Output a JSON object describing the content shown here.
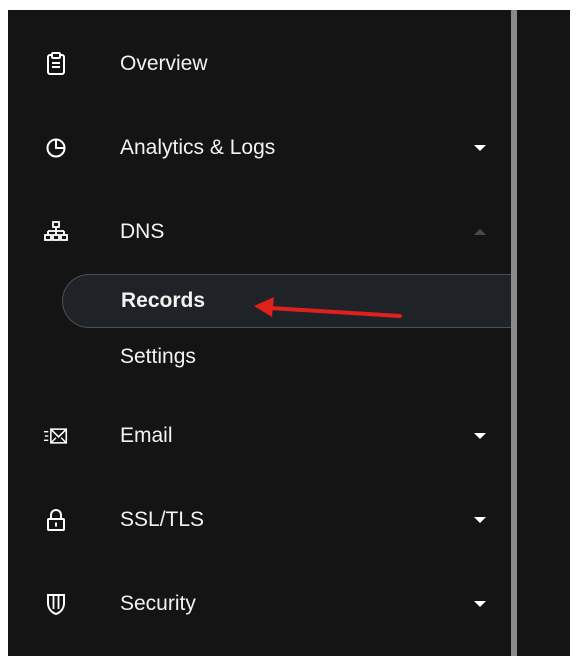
{
  "sidebar": {
    "items": [
      {
        "label": "Overview",
        "icon": "clipboard-icon"
      },
      {
        "label": "Analytics & Logs",
        "icon": "pie-chart-icon"
      },
      {
        "label": "DNS",
        "icon": "network-tree-icon"
      },
      {
        "label": "Email",
        "icon": "email-icon"
      },
      {
        "label": "SSL/TLS",
        "icon": "lock-icon"
      },
      {
        "label": "Security",
        "icon": "shield-icon"
      }
    ],
    "dns_subitems": [
      {
        "label": "Records",
        "active": true
      },
      {
        "label": "Settings",
        "active": false
      }
    ]
  },
  "colors": {
    "background": "#141414",
    "text": "#f2f2f2",
    "active_bg": "#1f2226",
    "annotation_arrow": "#e0201b"
  }
}
